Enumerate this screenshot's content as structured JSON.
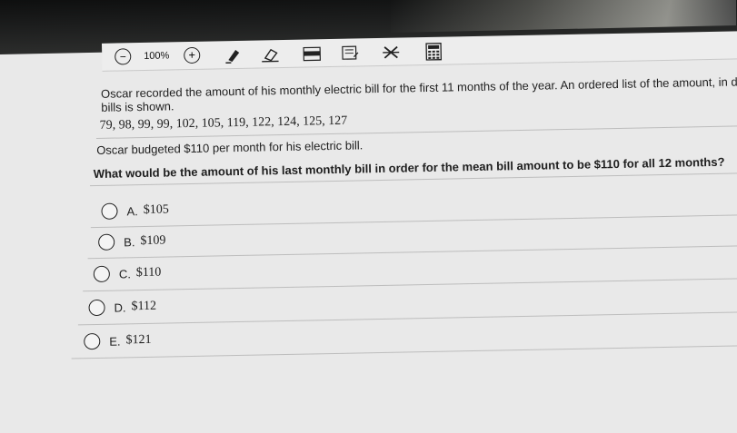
{
  "toolbar": {
    "zoom_level": "100%",
    "icons": [
      "zoom-out-icon",
      "zoom-in-icon",
      "highlighter-icon",
      "eraser-icon",
      "line-reader-icon",
      "notepad-icon",
      "strikethrough-icon",
      "calculator-icon"
    ]
  },
  "question": {
    "stem_line1": "Oscar recorded the amount of his monthly electric bill for the first 11 months of the year. An ordered list of the amount, in dol",
    "stem_line2": "bills is shown.",
    "data_list": "79, 98, 99, 99, 102, 105, 119, 122, 124, 125, 127",
    "budget_text": "Oscar budgeted $110 per month for his electric bill.",
    "prompt": "What would be the amount of his last monthly bill in order for the mean bill amount to be $110 for all 12 months?"
  },
  "choices": [
    {
      "letter": "A.",
      "value": "$105"
    },
    {
      "letter": "B.",
      "value": "$109"
    },
    {
      "letter": "C.",
      "value": "$110"
    },
    {
      "letter": "D.",
      "value": "$112"
    },
    {
      "letter": "E.",
      "value": "$121"
    }
  ]
}
